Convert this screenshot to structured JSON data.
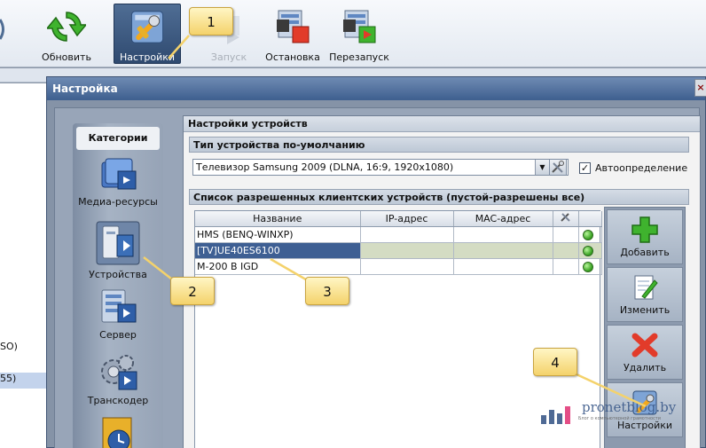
{
  "toolbar": {
    "buttons": [
      {
        "label": "Обновить",
        "icon": "refresh-icon",
        "state": "normal"
      },
      {
        "label": "Настройки",
        "icon": "settings-icon",
        "state": "active"
      },
      {
        "label": "Запуск",
        "icon": "play-icon",
        "state": "disabled"
      },
      {
        "label": "Остановка",
        "icon": "stop-icon",
        "state": "normal"
      },
      {
        "label": "Перезапуск",
        "icon": "restart-icon",
        "state": "normal"
      }
    ]
  },
  "background": {
    "left_fragments": [
      "SO)",
      "55)"
    ]
  },
  "dialog": {
    "title": "Настройка",
    "close_label": "×"
  },
  "categories": {
    "title": "Категории",
    "items": [
      {
        "label": "Медиа-ресурсы",
        "icon": "media-resources-icon"
      },
      {
        "label": "Устройства",
        "icon": "devices-icon"
      },
      {
        "label": "Сервер",
        "icon": "server-icon"
      },
      {
        "label": "Транскодер",
        "icon": "transcoder-icon"
      },
      {
        "label": "",
        "icon": "clock-icon"
      }
    ]
  },
  "device_settings": {
    "title": "Настройки устройств",
    "default_type": {
      "group_title": "Тип устройства по-умолчанию",
      "selected_value": "Телевизор Samsung 2009 (DLNA, 16:9, 1920x1080)",
      "autodetect_label": "Автоопределение",
      "autodetect_checked": true
    },
    "allowed_clients": {
      "group_title": "Список разрешенных клиентских устройств (пустой-разрешены все)",
      "columns": [
        "Название",
        "IP-адрес",
        "MAC-адрес"
      ],
      "rows": [
        {
          "name": "HMS (BENQ-WINXP)",
          "ip": "",
          "mac": "",
          "status": "green"
        },
        {
          "name": "[TV]UE40ES6100",
          "ip": "",
          "mac": "",
          "status": "green"
        },
        {
          "name": "M-200 B IGD",
          "ip": "",
          "mac": "",
          "status": "green"
        }
      ]
    },
    "actions": [
      {
        "label": "Добавить",
        "icon": "plus-icon"
      },
      {
        "label": "Изменить",
        "icon": "edit-icon"
      },
      {
        "label": "Удалить",
        "icon": "delete-icon"
      },
      {
        "label": "Настройки",
        "icon": "settings-icon"
      }
    ]
  },
  "watermark": {
    "text": "pronetblog.by",
    "subtext": "Блог о компьютерной грамотности"
  },
  "callouts": [
    "1",
    "2",
    "3",
    "4"
  ],
  "colors": {
    "accent_active": "#3e5f93",
    "callout": "#f4d26b",
    "status_green": "#3aa323"
  }
}
